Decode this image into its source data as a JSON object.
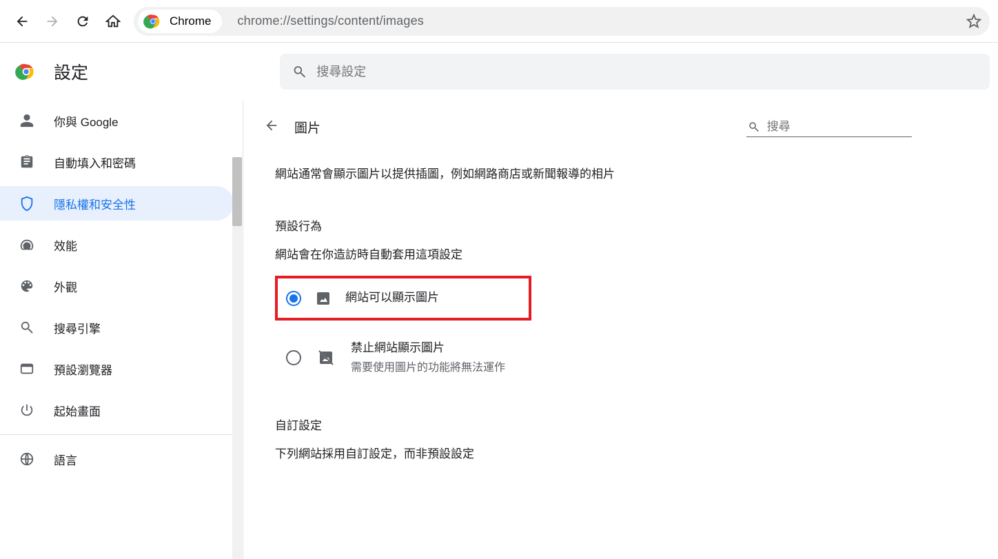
{
  "toolbar": {
    "chip_label": "Chrome",
    "url": "chrome://settings/content/images"
  },
  "header": {
    "title": "設定",
    "search_placeholder": "搜尋設定"
  },
  "sidebar": [
    {
      "icon": "person",
      "label": "你與 Google"
    },
    {
      "icon": "clipboard",
      "label": "自動填入和密碼"
    },
    {
      "icon": "shield",
      "label": "隱私權和安全性",
      "active": true
    },
    {
      "icon": "speed",
      "label": "效能"
    },
    {
      "icon": "palette",
      "label": "外觀"
    },
    {
      "icon": "search",
      "label": "搜尋引擎"
    },
    {
      "icon": "browser",
      "label": "預設瀏覽器"
    },
    {
      "icon": "power",
      "label": "起始畫面"
    },
    {
      "icon": "globe",
      "label": "語言"
    }
  ],
  "main": {
    "title": "圖片",
    "subsearch_placeholder": "搜尋",
    "description": "網站通常會顯示圖片以提供插圖，例如網路商店或新聞報導的相片",
    "default_title": "預設行為",
    "default_sub": "網站會在你造訪時自動套用這項設定",
    "option_allow": "網站可以顯示圖片",
    "option_block": "禁止網站顯示圖片",
    "option_block_sub": "需要使用圖片的功能將無法運作",
    "custom_title": "自訂設定",
    "custom_sub": "下列網站採用自訂設定，而非預設設定"
  }
}
